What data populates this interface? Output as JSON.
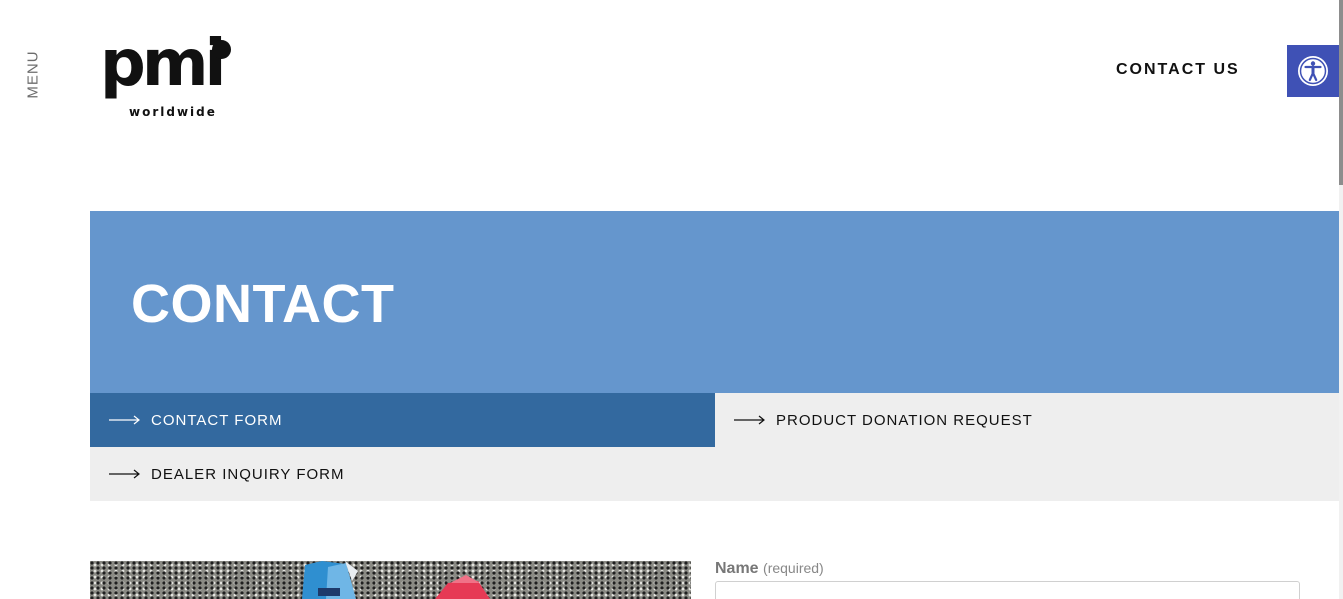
{
  "header": {
    "menu_label": "MENU",
    "logo": {
      "main": "pmi",
      "sub": "worldwide"
    },
    "contact_link": "CONTACT US",
    "accessibility_icon": "accessibility-icon",
    "accent_color": "#3f51b5"
  },
  "hero": {
    "title": "CONTACT",
    "background_color": "#6596cd"
  },
  "subnav": {
    "items": [
      {
        "label": "CONTACT FORM",
        "active": true,
        "icon": "arrow-right-icon"
      },
      {
        "label": "PRODUCT DONATION REQUEST",
        "active": false,
        "icon": "arrow-right-icon"
      },
      {
        "label": "DEALER INQUIRY FORM",
        "active": false,
        "icon": "arrow-right-icon"
      }
    ],
    "active_color": "#33699f",
    "inactive_color": "#eeeeee"
  },
  "form": {
    "name_label": "Name",
    "name_required": "(required)",
    "name_value": ""
  }
}
